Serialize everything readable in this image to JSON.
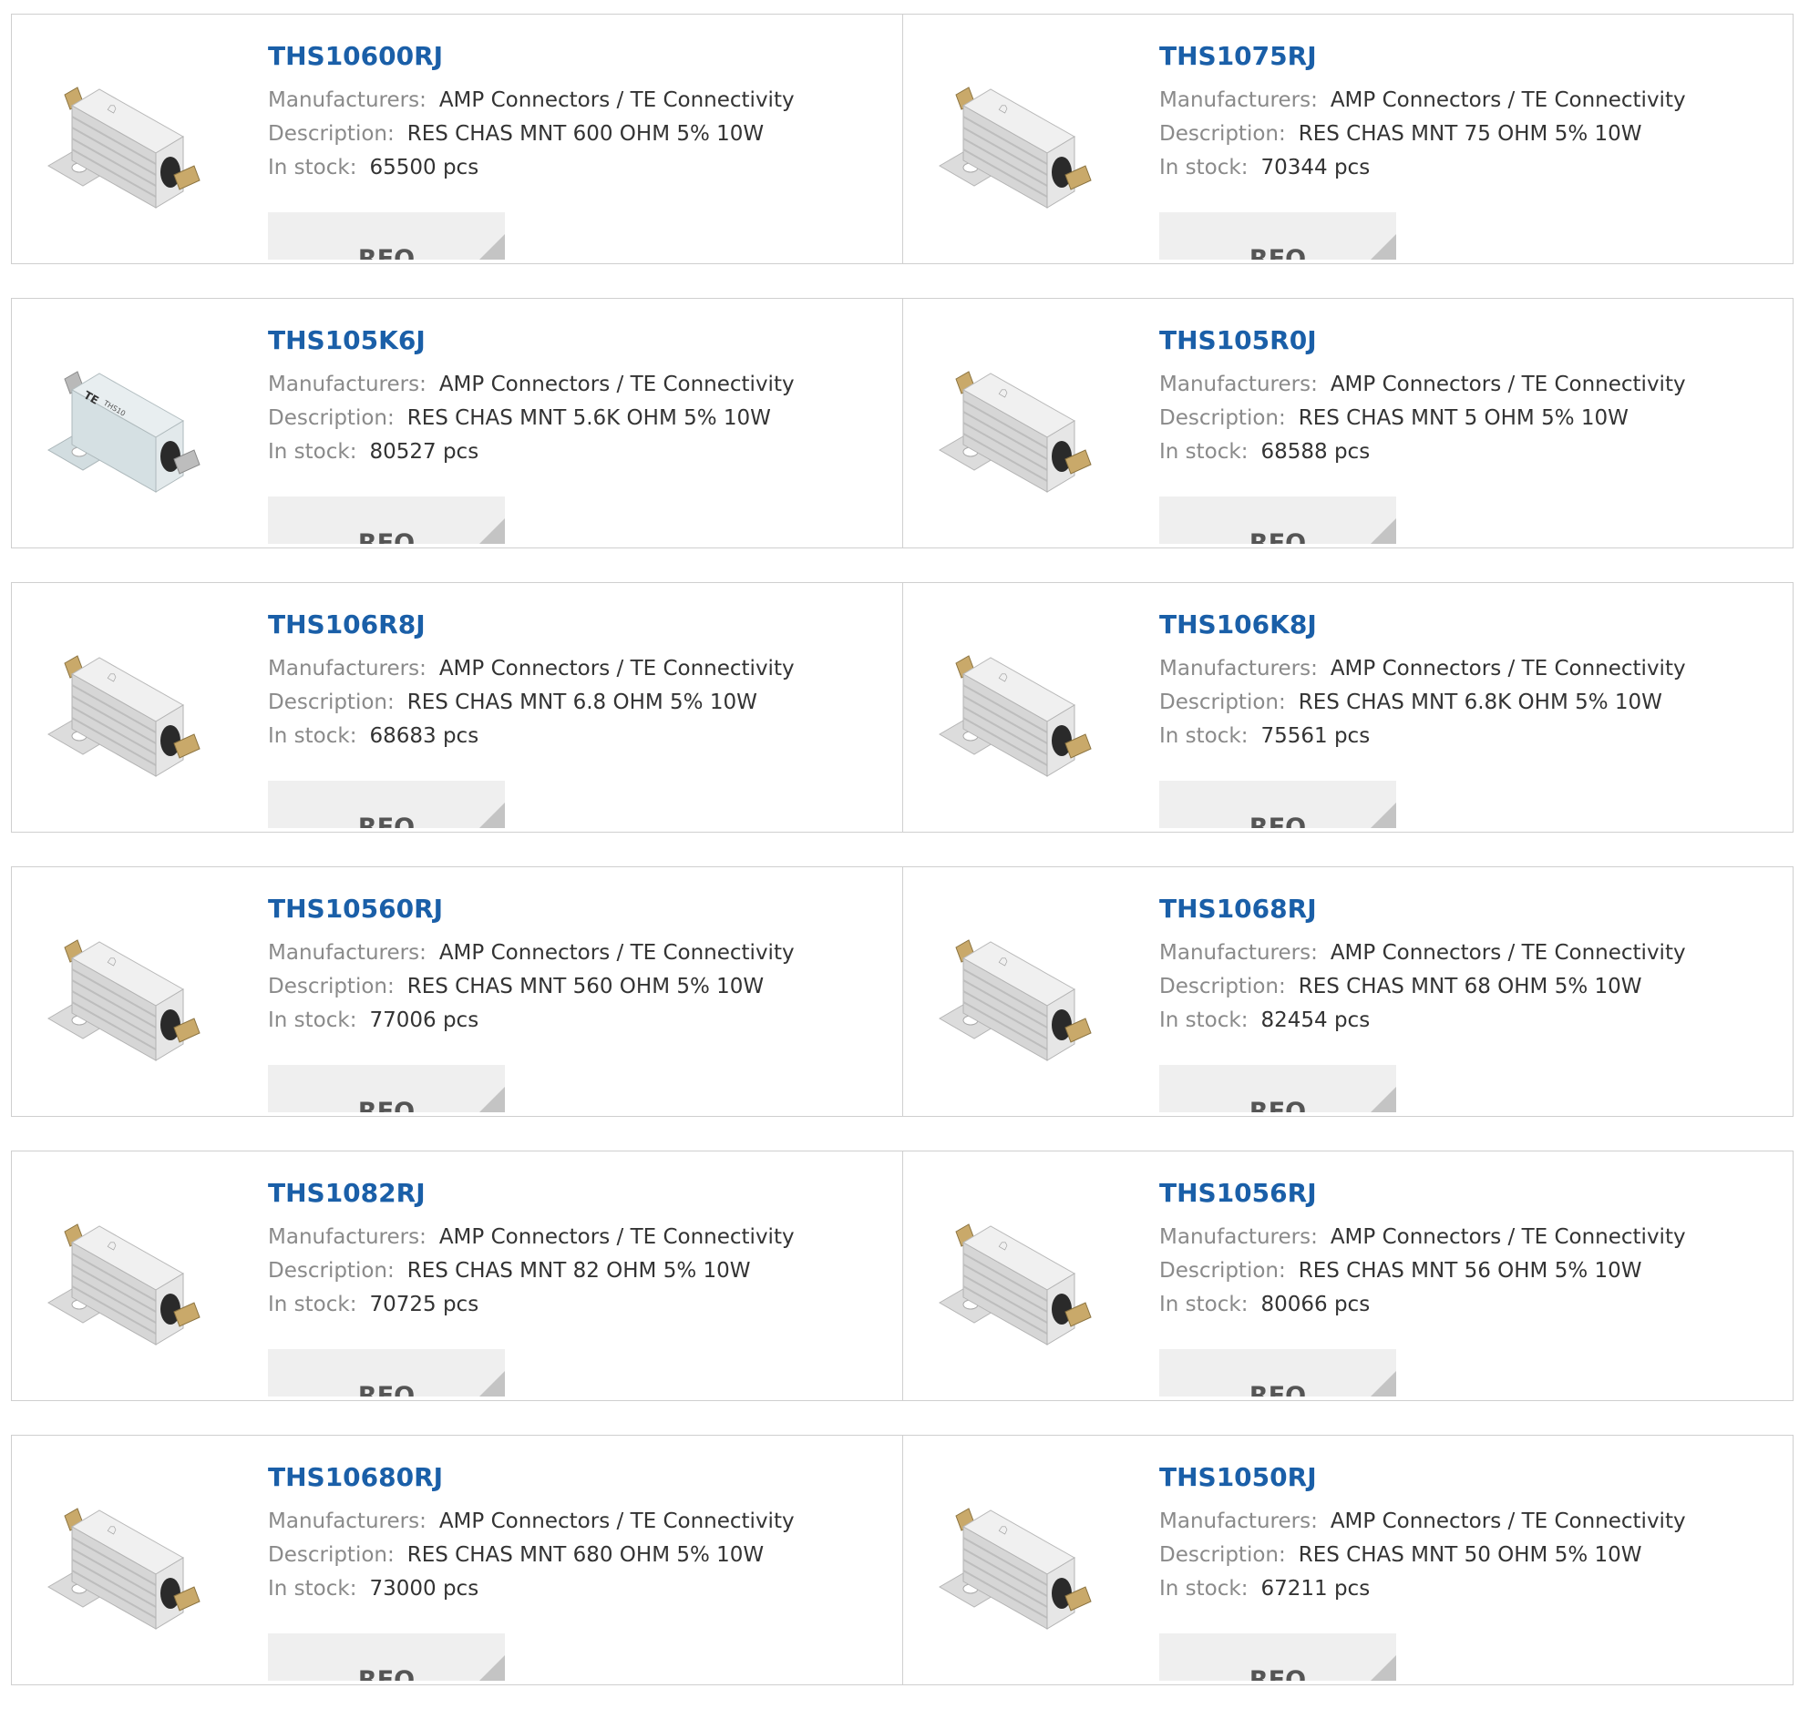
{
  "labels": {
    "manufacturers": "Manufacturers:",
    "description": "Description:",
    "in_stock": "In stock:",
    "rfq": "RFQ"
  },
  "products": [
    {
      "part": "THS10600RJ",
      "manufacturer": "AMP Connectors / TE Connectivity",
      "description": "RES CHAS MNT 600 OHM 5% 10W",
      "stock": "65500 pcs",
      "image": "resistor-heatsink-icon"
    },
    {
      "part": "THS1075RJ",
      "manufacturer": "AMP Connectors / TE Connectivity",
      "description": "RES CHAS MNT 75 OHM 5% 10W",
      "stock": "70344 pcs",
      "image": "resistor-heatsink-icon"
    },
    {
      "part": "THS105K6J",
      "manufacturer": "AMP Connectors / TE Connectivity",
      "description": "RES CHAS MNT 5.6K OHM 5% 10W",
      "stock": "80527 pcs",
      "image": "resistor-smooth-icon"
    },
    {
      "part": "THS105R0J",
      "manufacturer": "AMP Connectors / TE Connectivity",
      "description": "RES CHAS MNT 5 OHM 5% 10W",
      "stock": "68588 pcs",
      "image": "resistor-heatsink-icon"
    },
    {
      "part": "THS106R8J",
      "manufacturer": "AMP Connectors / TE Connectivity",
      "description": "RES CHAS MNT 6.8 OHM 5% 10W",
      "stock": "68683 pcs",
      "image": "resistor-heatsink-icon"
    },
    {
      "part": "THS106K8J",
      "manufacturer": "AMP Connectors / TE Connectivity",
      "description": "RES CHAS MNT 6.8K OHM 5% 10W",
      "stock": "75561 pcs",
      "image": "resistor-heatsink-icon"
    },
    {
      "part": "THS10560RJ",
      "manufacturer": "AMP Connectors / TE Connectivity",
      "description": "RES CHAS MNT 560 OHM 5% 10W",
      "stock": "77006 pcs",
      "image": "resistor-heatsink-icon"
    },
    {
      "part": "THS1068RJ",
      "manufacturer": "AMP Connectors / TE Connectivity",
      "description": "RES CHAS MNT 68 OHM 5% 10W",
      "stock": "82454 pcs",
      "image": "resistor-heatsink-icon"
    },
    {
      "part": "THS1082RJ",
      "manufacturer": "AMP Connectors / TE Connectivity",
      "description": "RES CHAS MNT 82 OHM 5% 10W",
      "stock": "70725 pcs",
      "image": "resistor-heatsink-icon"
    },
    {
      "part": "THS1056RJ",
      "manufacturer": "AMP Connectors / TE Connectivity",
      "description": "RES CHAS MNT 56 OHM 5% 10W",
      "stock": "80066 pcs",
      "image": "resistor-heatsink-icon"
    },
    {
      "part": "THS10680RJ",
      "manufacturer": "AMP Connectors / TE Connectivity",
      "description": "RES CHAS MNT 680 OHM 5% 10W",
      "stock": "73000 pcs",
      "image": "resistor-heatsink-icon"
    },
    {
      "part": "THS1050RJ",
      "manufacturer": "AMP Connectors / TE Connectivity",
      "description": "RES CHAS MNT 50 OHM 5% 10W",
      "stock": "67211 pcs",
      "image": "resistor-heatsink-icon"
    }
  ],
  "colors": {
    "part_link": "#1a5fa8",
    "label": "#8a8a8a",
    "value": "#333333",
    "rfq_bg": "#efefef",
    "border": "#cfcfcf"
  }
}
